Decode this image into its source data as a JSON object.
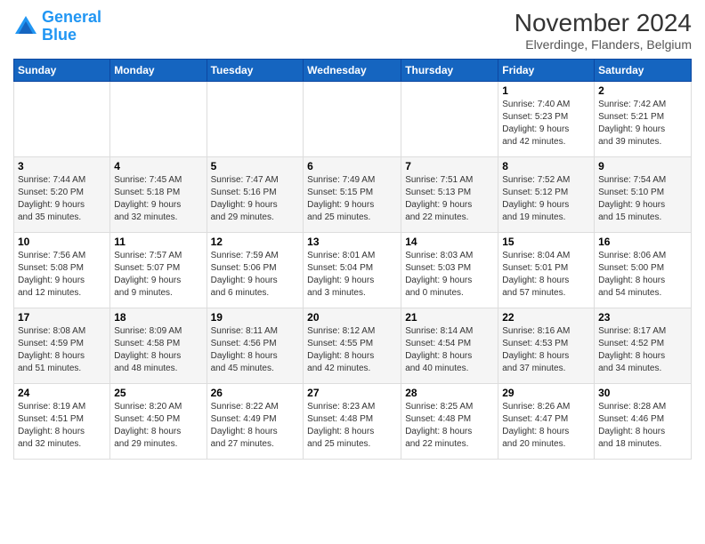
{
  "logo": {
    "line1": "General",
    "line2": "Blue"
  },
  "title": "November 2024",
  "subtitle": "Elverdinge, Flanders, Belgium",
  "weekdays": [
    "Sunday",
    "Monday",
    "Tuesday",
    "Wednesday",
    "Thursday",
    "Friday",
    "Saturday"
  ],
  "weeks": [
    [
      {
        "day": "",
        "info": ""
      },
      {
        "day": "",
        "info": ""
      },
      {
        "day": "",
        "info": ""
      },
      {
        "day": "",
        "info": ""
      },
      {
        "day": "",
        "info": ""
      },
      {
        "day": "1",
        "info": "Sunrise: 7:40 AM\nSunset: 5:23 PM\nDaylight: 9 hours\nand 42 minutes."
      },
      {
        "day": "2",
        "info": "Sunrise: 7:42 AM\nSunset: 5:21 PM\nDaylight: 9 hours\nand 39 minutes."
      }
    ],
    [
      {
        "day": "3",
        "info": "Sunrise: 7:44 AM\nSunset: 5:20 PM\nDaylight: 9 hours\nand 35 minutes."
      },
      {
        "day": "4",
        "info": "Sunrise: 7:45 AM\nSunset: 5:18 PM\nDaylight: 9 hours\nand 32 minutes."
      },
      {
        "day": "5",
        "info": "Sunrise: 7:47 AM\nSunset: 5:16 PM\nDaylight: 9 hours\nand 29 minutes."
      },
      {
        "day": "6",
        "info": "Sunrise: 7:49 AM\nSunset: 5:15 PM\nDaylight: 9 hours\nand 25 minutes."
      },
      {
        "day": "7",
        "info": "Sunrise: 7:51 AM\nSunset: 5:13 PM\nDaylight: 9 hours\nand 22 minutes."
      },
      {
        "day": "8",
        "info": "Sunrise: 7:52 AM\nSunset: 5:12 PM\nDaylight: 9 hours\nand 19 minutes."
      },
      {
        "day": "9",
        "info": "Sunrise: 7:54 AM\nSunset: 5:10 PM\nDaylight: 9 hours\nand 15 minutes."
      }
    ],
    [
      {
        "day": "10",
        "info": "Sunrise: 7:56 AM\nSunset: 5:08 PM\nDaylight: 9 hours\nand 12 minutes."
      },
      {
        "day": "11",
        "info": "Sunrise: 7:57 AM\nSunset: 5:07 PM\nDaylight: 9 hours\nand 9 minutes."
      },
      {
        "day": "12",
        "info": "Sunrise: 7:59 AM\nSunset: 5:06 PM\nDaylight: 9 hours\nand 6 minutes."
      },
      {
        "day": "13",
        "info": "Sunrise: 8:01 AM\nSunset: 5:04 PM\nDaylight: 9 hours\nand 3 minutes."
      },
      {
        "day": "14",
        "info": "Sunrise: 8:03 AM\nSunset: 5:03 PM\nDaylight: 9 hours\nand 0 minutes."
      },
      {
        "day": "15",
        "info": "Sunrise: 8:04 AM\nSunset: 5:01 PM\nDaylight: 8 hours\nand 57 minutes."
      },
      {
        "day": "16",
        "info": "Sunrise: 8:06 AM\nSunset: 5:00 PM\nDaylight: 8 hours\nand 54 minutes."
      }
    ],
    [
      {
        "day": "17",
        "info": "Sunrise: 8:08 AM\nSunset: 4:59 PM\nDaylight: 8 hours\nand 51 minutes."
      },
      {
        "day": "18",
        "info": "Sunrise: 8:09 AM\nSunset: 4:58 PM\nDaylight: 8 hours\nand 48 minutes."
      },
      {
        "day": "19",
        "info": "Sunrise: 8:11 AM\nSunset: 4:56 PM\nDaylight: 8 hours\nand 45 minutes."
      },
      {
        "day": "20",
        "info": "Sunrise: 8:12 AM\nSunset: 4:55 PM\nDaylight: 8 hours\nand 42 minutes."
      },
      {
        "day": "21",
        "info": "Sunrise: 8:14 AM\nSunset: 4:54 PM\nDaylight: 8 hours\nand 40 minutes."
      },
      {
        "day": "22",
        "info": "Sunrise: 8:16 AM\nSunset: 4:53 PM\nDaylight: 8 hours\nand 37 minutes."
      },
      {
        "day": "23",
        "info": "Sunrise: 8:17 AM\nSunset: 4:52 PM\nDaylight: 8 hours\nand 34 minutes."
      }
    ],
    [
      {
        "day": "24",
        "info": "Sunrise: 8:19 AM\nSunset: 4:51 PM\nDaylight: 8 hours\nand 32 minutes."
      },
      {
        "day": "25",
        "info": "Sunrise: 8:20 AM\nSunset: 4:50 PM\nDaylight: 8 hours\nand 29 minutes."
      },
      {
        "day": "26",
        "info": "Sunrise: 8:22 AM\nSunset: 4:49 PM\nDaylight: 8 hours\nand 27 minutes."
      },
      {
        "day": "27",
        "info": "Sunrise: 8:23 AM\nSunset: 4:48 PM\nDaylight: 8 hours\nand 25 minutes."
      },
      {
        "day": "28",
        "info": "Sunrise: 8:25 AM\nSunset: 4:48 PM\nDaylight: 8 hours\nand 22 minutes."
      },
      {
        "day": "29",
        "info": "Sunrise: 8:26 AM\nSunset: 4:47 PM\nDaylight: 8 hours\nand 20 minutes."
      },
      {
        "day": "30",
        "info": "Sunrise: 8:28 AM\nSunset: 4:46 PM\nDaylight: 8 hours\nand 18 minutes."
      }
    ]
  ]
}
